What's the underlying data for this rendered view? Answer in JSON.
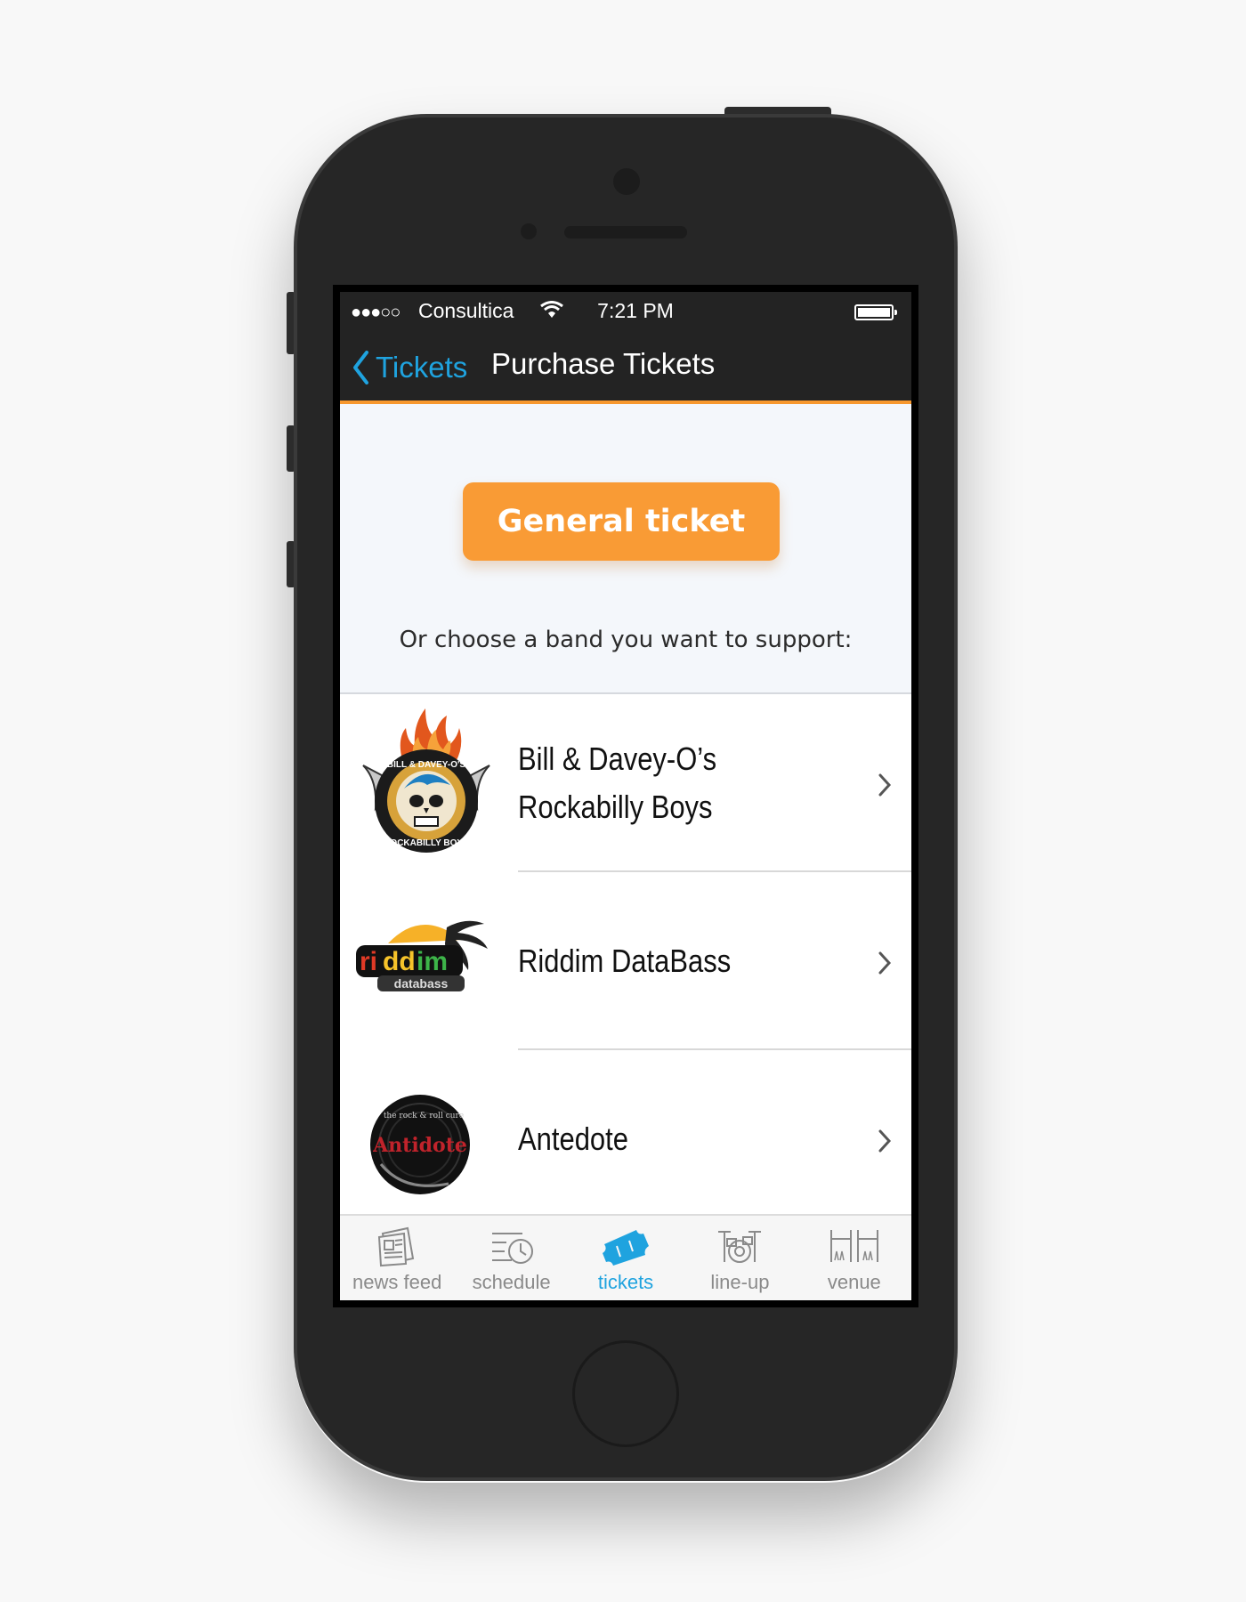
{
  "status_bar": {
    "carrier": "Consultica",
    "time": "7:21 PM"
  },
  "nav": {
    "back_label": "Tickets",
    "title": "Purchase Tickets"
  },
  "main": {
    "general_ticket_label": "General ticket",
    "support_prompt": "Or choose a band you want to support:"
  },
  "bands": [
    {
      "name_line1": "Bill & Davey-O’s",
      "name_line2": "Rockabilly Boys",
      "logo_text": "BILL & DAVEY-O'S ROCKABILLY BOYS"
    },
    {
      "name_line1": "Riddim DataBass",
      "name_line2": "",
      "logo_text": "riddim databass"
    },
    {
      "name_line1": "Antedote",
      "name_line2": "",
      "logo_text": "Antidote"
    }
  ],
  "tabs": [
    {
      "label": "news feed",
      "icon": "newspaper-icon"
    },
    {
      "label": "schedule",
      "icon": "clock-icon"
    },
    {
      "label": "tickets",
      "icon": "ticket-icon",
      "active": true
    },
    {
      "label": "line-up",
      "icon": "drum-kit-icon"
    },
    {
      "label": "venue",
      "icon": "venue-icon"
    }
  ],
  "colors": {
    "accent": "#1fa3df",
    "orange": "#f99b35",
    "bar": "#232323"
  }
}
